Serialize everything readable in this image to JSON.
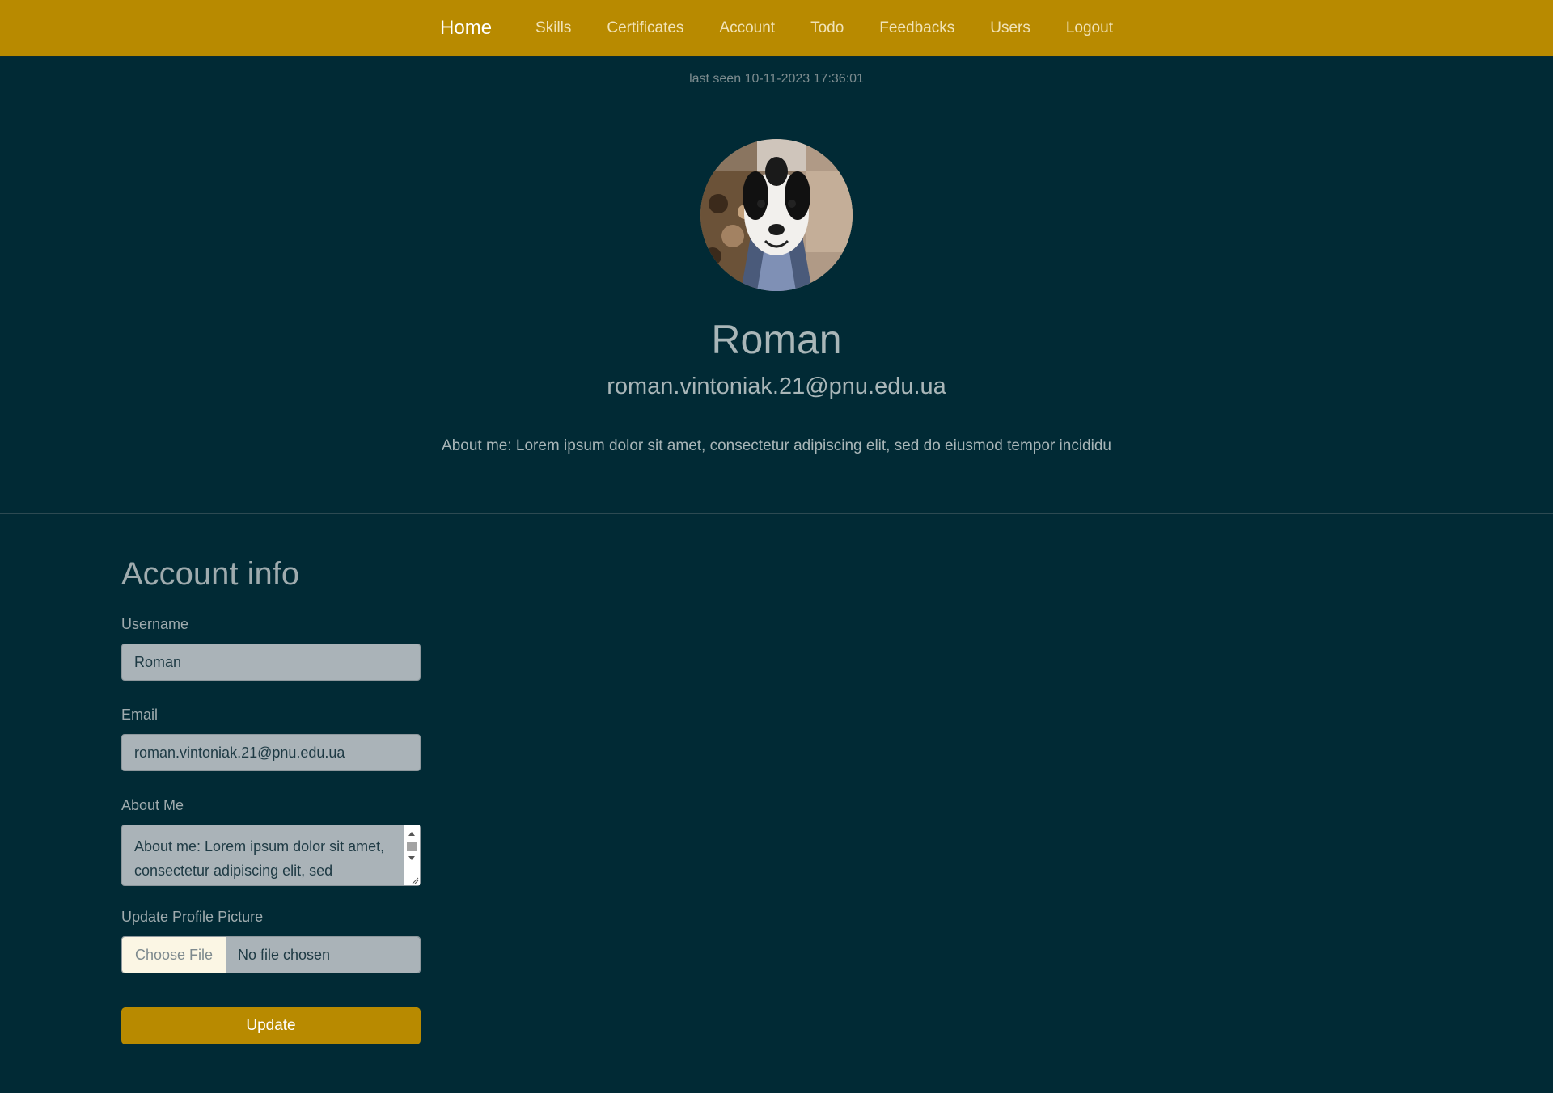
{
  "nav": {
    "items": [
      {
        "label": "Home",
        "active": true
      },
      {
        "label": "Skills"
      },
      {
        "label": "Certificates"
      },
      {
        "label": "Account"
      },
      {
        "label": "Todo"
      },
      {
        "label": "Feedbacks"
      },
      {
        "label": "Users"
      },
      {
        "label": "Logout"
      }
    ]
  },
  "profile": {
    "last_seen": "last seen 10-11-2023 17:36:01",
    "name": "Roman",
    "email": "roman.vintoniak.21@pnu.edu.ua",
    "about": "About me: Lorem ipsum dolor sit amet, consectetur adipiscing elit, sed do eiusmod tempor incididu",
    "avatar_icon": "dog-photo-avatar"
  },
  "account_form": {
    "title": "Account info",
    "username_label": "Username",
    "username_value": "Roman",
    "email_label": "Email",
    "email_value": "roman.vintoniak.21@pnu.edu.ua",
    "about_label": "About Me",
    "about_value": "About me: Lorem ipsum dolor sit amet, consectetur adipiscing elit, sed",
    "picture_label": "Update Profile Picture",
    "choose_file_label": "Choose File",
    "file_status": "No file chosen",
    "update_label": "Update"
  },
  "colors": {
    "navbar": "#b88a00",
    "background": "#012a35",
    "accent": "#b88a00",
    "input_bg": "#aab3b8"
  }
}
